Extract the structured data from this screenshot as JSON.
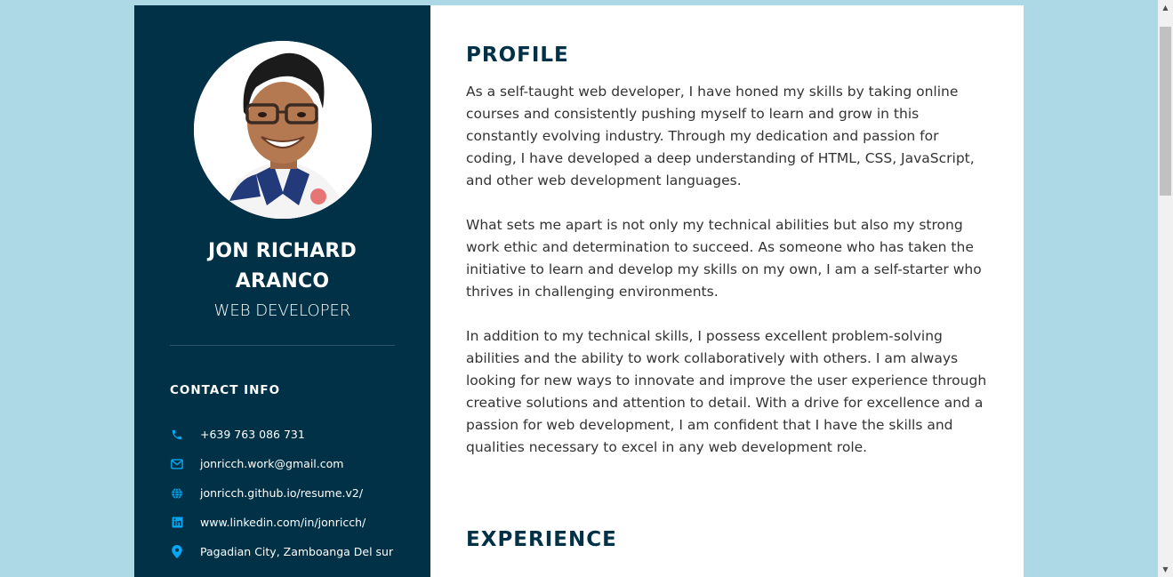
{
  "sidebar": {
    "name_line1": "JON RICHARD",
    "name_line2": "ARANCO",
    "role": "WEB DEVELOPER",
    "contact_title": "CONTACT INFO",
    "contacts": [
      {
        "icon": "phone-icon",
        "text": "+639 763 086 731"
      },
      {
        "icon": "envelope-icon",
        "text": "jonricch.work@gmail.com"
      },
      {
        "icon": "globe-icon",
        "text": "jonricch.github.io/resume.v2/"
      },
      {
        "icon": "linkedin-icon",
        "text": "www.linkedin.com/in/jonricch/"
      },
      {
        "icon": "location-pin-icon",
        "text": "Pagadian City, Zamboanga Del sur"
      }
    ],
    "accent_color": "#03a9f4",
    "background_color": "#003147"
  },
  "main": {
    "profile_title": "PROFILE",
    "profile_paragraphs": [
      "As a self-taught web developer, I have honed my skills by taking online courses and consistently pushing myself to learn and grow in this constantly evolving industry. Through my dedication and passion for coding, I have developed a deep understanding of HTML, CSS, JavaScript, and other web development languages.",
      "What sets me apart is not only my technical abilities but also my strong work ethic and determination to succeed. As someone who has taken the initiative to learn and develop my skills on my own, I am a self-starter who thrives in challenging environments.",
      "In addition to my technical skills, I possess excellent problem-solving abilities and the ability to work collaboratively with others. I am always looking for new ways to innovate and improve the user experience through creative solutions and attention to detail. With a drive for excellence and a passion for web development, I am confident that I have the skills and qualities necessary to excel in any web development role."
    ],
    "experience_title": "EXPERIENCE",
    "title_color": "#003147"
  },
  "page": {
    "background_color": "#add8e6"
  }
}
